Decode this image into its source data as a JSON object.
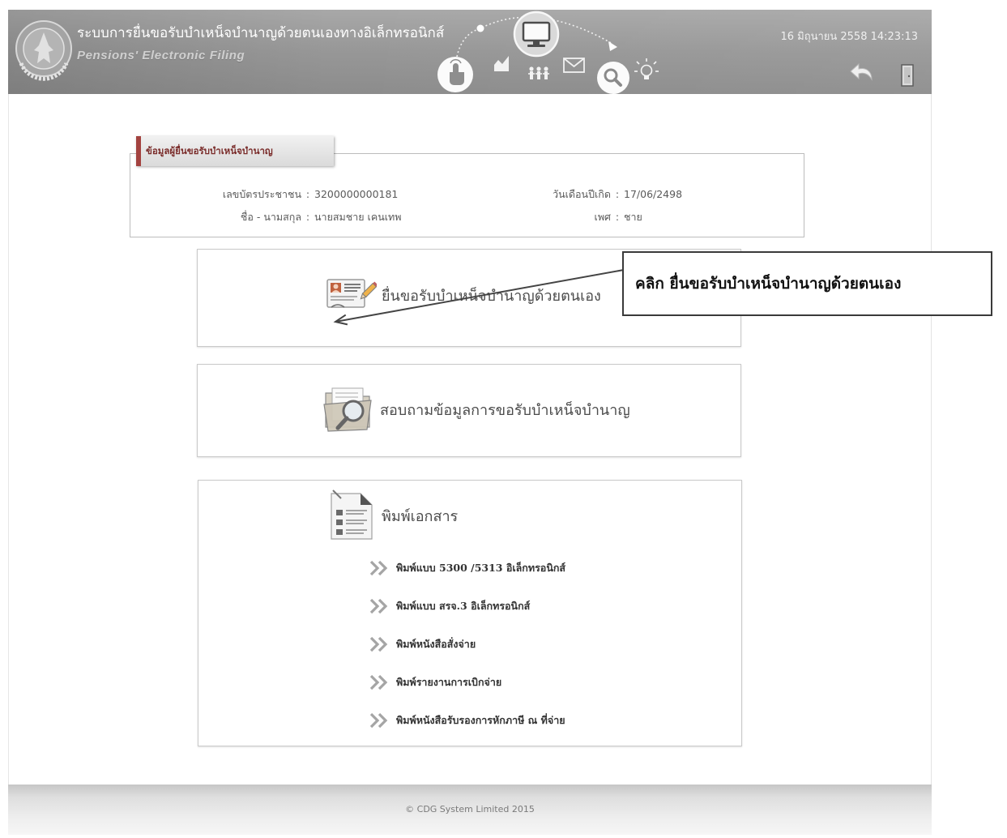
{
  "header": {
    "title": "ระบบการยื่นขอรับบำเหน็จบำนาญด้วยตนเองทางอิเล็กทรอนิกส์",
    "subtitle": "Pensions' Electronic Filing",
    "datetime": "16 มิถุนายน 2558 14:23:13",
    "logo_icon": "department-seal-logo",
    "feature_icons": [
      "touch-icon",
      "chart-icon",
      "people-icon",
      "mail-icon",
      "monitor-icon",
      "cursor-pointer-icon",
      "search-icon",
      "lightbulb-icon"
    ],
    "actions": [
      {
        "name": "back",
        "icon": "back-arrow-icon"
      },
      {
        "name": "logout",
        "icon": "exit-door-icon"
      }
    ]
  },
  "applicant": {
    "section_title": "ข้อมูลผู้ยื่นขอรับบำเหน็จบำนาญ",
    "separator": ":",
    "fields": [
      {
        "label": "เลขบัตรประชาชน",
        "value": "3200000000181"
      },
      {
        "label": "วันเดือนปีเกิด",
        "value": "17/06/2498"
      },
      {
        "label": "ชื่อ - นามสกุล",
        "value": "นายสมชาย เคนเทพ"
      },
      {
        "label": "เพศ",
        "value": "ชาย"
      }
    ]
  },
  "menu": {
    "file_pension": {
      "label": "ยื่นขอรับบำเหน็จบำนาญด้วยตนเอง",
      "icon": "document-edit-icon"
    },
    "inquiry": {
      "label": "สอบถามข้อมูลการขอรับบำเหน็จบำนาญ",
      "icon": "folder-search-icon"
    },
    "print": {
      "title": "พิมพ์เอกสาร",
      "icon": "print-document-icon",
      "item_icon": "double-chevron-right-icon",
      "items": [
        "พิมพ์แบบ 5300 /5313 อิเล็กทรอนิกส์",
        "พิมพ์แบบ สรจ.3 อิเล็กทรอนิกส์",
        "พิมพ์หนังสือสั่งจ่าย",
        "พิมพ์รายงานการเบิกจ่าย",
        "พิมพ์หนังสือรับรองการหักภาษี ณ ที่จ่าย"
      ]
    }
  },
  "annotation": {
    "callout_text": "คลิก ยื่นขอรับบำเหน็จบำนาญด้วยตนเอง"
  },
  "footer": {
    "copyright": "© CDG System Limited 2015"
  },
  "colors": {
    "header_bg": "#979797",
    "header_text": "#ffffff",
    "tab_accent": "#a3423f",
    "section_title": "#7a2c2a",
    "card_border": "#c9c9c9",
    "callout_border": "#3a3a3a"
  }
}
